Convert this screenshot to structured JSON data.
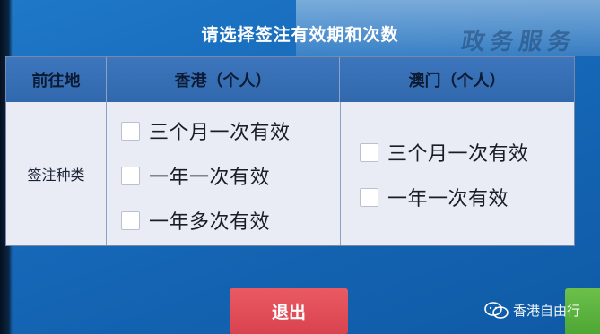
{
  "header": {
    "title": "请选择签注有效期和次数",
    "background_text": "政务服务"
  },
  "table": {
    "columns": [
      "前往地",
      "香港（个人）",
      "澳门（个人）"
    ],
    "row_label": "签注种类",
    "hongkong_options": [
      "三个月一次有效",
      "一年一次有效",
      "一年多次有效"
    ],
    "macau_options": [
      "三个月一次有效",
      "一年一次有效"
    ]
  },
  "buttons": {
    "exit_label": "退出"
  },
  "watermark": {
    "text": "香港自由行"
  },
  "colors": {
    "background": "#1668b8",
    "header_row": "#3168ad",
    "table_body": "#e9ecf4",
    "exit_button": "#d9434d",
    "next_button": "#4ea634"
  }
}
